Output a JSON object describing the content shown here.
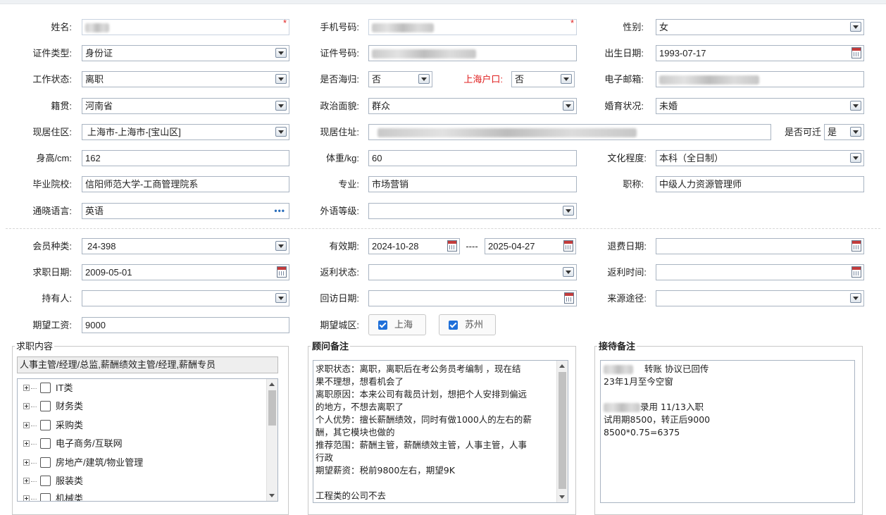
{
  "personal": {
    "name_label": "姓名:",
    "phone_label": "手机号码:",
    "gender_label": "性别:",
    "gender_value": "女",
    "id_type_label": "证件类型:",
    "id_type_value": "身份证",
    "id_number_label": "证件号码:",
    "birth_label": "出生日期:",
    "birth_value": "1993-07-17",
    "work_status_label": "工作状态:",
    "work_status_value": "离职",
    "returnee_label": "是否海归:",
    "returnee_value": "否",
    "shanghai_hukou_label": "上海户口:",
    "shanghai_hukou_value": "否",
    "email_label": "电子邮箱:",
    "native_label": "籍贯:",
    "native_value": "河南省",
    "political_label": "政治面貌:",
    "political_value": "群众",
    "marital_label": "婚育状况:",
    "marital_value": "未婚",
    "residence_area_label": "现居住区:",
    "residence_area_value": "上海市-上海市-[宝山区]",
    "residence_addr_label": "现居住址:",
    "relocate_label": "是否可迁",
    "relocate_value": "是",
    "height_label": "身高/cm:",
    "height_value": "162",
    "weight_label": "体重/kg:",
    "weight_value": "60",
    "education_label": "文化程度:",
    "education_value": "本科（全日制）",
    "school_label": "毕业院校:",
    "school_value": "信阳师范大学-工商管理院系",
    "major_label": "专业:",
    "major_value": "市场营销",
    "title_label": "职称:",
    "title_value": "中级人力资源管理师",
    "language_label": "通晓语言:",
    "language_value": "英语",
    "language_more": "•••",
    "foreign_level_label": "外语等级:",
    "foreign_level_value": ""
  },
  "membership": {
    "member_type_label": "会员种类:",
    "member_type_value": "24-398",
    "validity_label": "有效期:",
    "validity_start": "2024-10-28",
    "validity_sep": "----",
    "validity_end": "2025-04-27",
    "refund_date_label": "退费日期:",
    "job_date_label": "求职日期:",
    "job_date_value": "2009-05-01",
    "rebate_status_label": "返利状态:",
    "rebate_time_label": "返利时间:",
    "holder_label": "持有人:",
    "revisit_label": "回访日期:",
    "source_label": "来源途径:",
    "salary_label": "期望工资:",
    "salary_value": "9000",
    "city_label": "期望城区:",
    "city_options": [
      "上海",
      "苏州"
    ]
  },
  "job_content": {
    "title": "求职内容",
    "selected": "人事主管/经理/总监,薪酬绩效主管/经理,薪酬专员",
    "categories": [
      "IT类",
      "财务类",
      "采购类",
      "电子商务/互联网",
      "房地产/建筑/物业管理",
      "服装类",
      "机械类"
    ]
  },
  "consultant_notes": {
    "title": "顾问备注",
    "lines": [
      "求职状态：离职，离职后在考公务员考编制 ，现在结",
      "果不理想，想看机会了",
      "离职原因：本来公司有裁员计划，想把个人安排到偏远",
      "的地方，不想去离职了",
      "个人优势：擅长薪酬绩效，同时有做1000人的左右的薪",
      "酬，其它模块也做的",
      "推荐范围：薪酬主管，薪酬绩效主管，人事主管，人事",
      "行政",
      "期望薪资：税前9800左右，期望9K",
      "",
      "工程类的公司不去"
    ]
  },
  "reception_notes": {
    "title": "接待备注",
    "line1": "转账 协议已回传",
    "line2": "23年1月至今空窗",
    "line3": "录用 11/13入职",
    "line4": "试用期8500，转正后9000",
    "line5": "8500*0.75=6375"
  },
  "colors": {
    "required": "#e02020",
    "checkbox": "#1e6fd9",
    "border": "#a9b4c2"
  }
}
